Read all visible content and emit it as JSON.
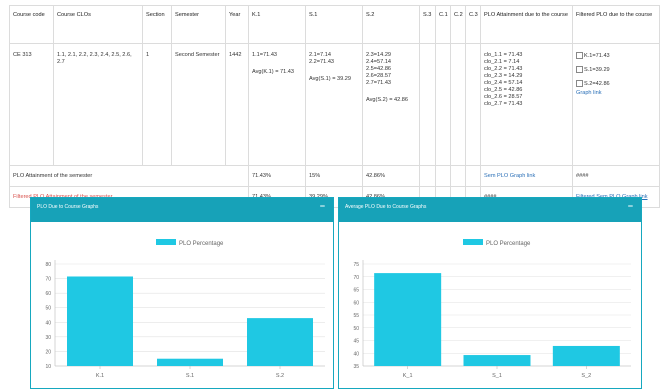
{
  "table": {
    "headers": [
      "Course code",
      "Course CLOs",
      "Section",
      "Semester",
      "Year",
      "K.1",
      "S.1",
      "S.2",
      "S.3",
      "C.1",
      "C.2",
      "C.3",
      "PLO Attainment due to the course",
      "Filtered PLO due to the course"
    ],
    "row": {
      "course_code": "CE 313",
      "clos": "1.1, 2.1, 2.2, 2.3, 2.4, 2.5, 2.6, 2.7",
      "section": "1",
      "semester": "Second Semester",
      "year": "1442",
      "k1_lines": [
        "1.1=71.43"
      ],
      "k1_avg": "Avg(K.1) = 71.43",
      "s1_lines": [
        "2.1=7.14",
        "2.2=71.43"
      ],
      "s1_avg": "Avg(S.1) = 39.29",
      "s2_lines": [
        "2.3=14.29",
        "2.4=57.14",
        "2.5=42.86",
        "2.6=28.57",
        "2.7=71.43"
      ],
      "s2_avg": "Avg(S.2) = 42.86",
      "plo_lines": [
        "clo_1.1 = 71.43",
        "clo_2.1 = 7.14",
        "clo_2.2 = 71.43",
        "clo_2.3 = 14.29",
        "clo_2.4 = 57.14",
        "clo_2.5 = 42.86",
        "clo_2.6 = 28.57",
        "clo_2.7 = 71.43"
      ],
      "filter_items": [
        "K.1=71.43",
        "S.1=39.29",
        "S.2=42.86"
      ],
      "graph_link": "Graph link"
    },
    "semester_row": {
      "label": "PLO Attainment of the semester",
      "k1": "71.43%",
      "s1": "15%",
      "s2": "42.86%",
      "link": "Sem PLO Graph link",
      "hashes": "####"
    },
    "filtered_row": {
      "label": "Filtered PLO Attainment of the semester",
      "k1": "71.43%",
      "s1": "39.29%",
      "s2": "42.86%",
      "hashes": "####",
      "link": "Filtered Sem PLO Graph link"
    }
  },
  "panels": {
    "left_title": "PLO Due to Course Graphs",
    "right_title": "Average PLO Due to Course Graphs",
    "minimize": "−"
  },
  "chart_data": [
    {
      "type": "bar",
      "title": "",
      "legend": "PLO Percentage",
      "categories": [
        "K.1",
        "S.1",
        "S.2"
      ],
      "values": [
        71.43,
        15,
        42.86
      ],
      "ylim": [
        10,
        80
      ],
      "yticks": [
        10,
        20,
        30,
        40,
        50,
        60,
        70,
        80
      ],
      "color": "#1fc8e3",
      "grid": true
    },
    {
      "type": "bar",
      "title": "",
      "legend": "PLO Percentage",
      "categories": [
        "K_1",
        "S_1",
        "S_2"
      ],
      "values": [
        71.43,
        39.29,
        42.86
      ],
      "ylim": [
        35,
        75
      ],
      "yticks": [
        35,
        40,
        45,
        50,
        55,
        60,
        65,
        70,
        75
      ],
      "color": "#1fc8e3",
      "grid": true
    }
  ]
}
